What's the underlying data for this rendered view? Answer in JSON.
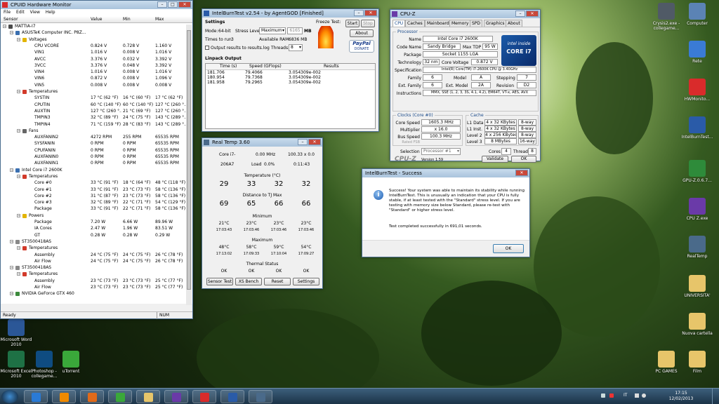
{
  "hwmon": {
    "title": "CPUID Hardware Monitor",
    "menu": [
      "File",
      "Edit",
      "View",
      "Help"
    ],
    "headers": [
      "Sensor",
      "Value",
      "Min",
      "Max"
    ],
    "rows": [
      {
        "indent": 0,
        "icon": "#4a4a4a",
        "label": "MATTIA-I7",
        "v": "",
        "mn": "",
        "mx": ""
      },
      {
        "indent": 1,
        "icon": "#3a6fb0",
        "label": "ASUSTeK Computer INC. P8Z...",
        "v": "",
        "mn": "",
        "mx": ""
      },
      {
        "indent": 2,
        "icon": "#e2b400",
        "label": "Voltages",
        "v": "",
        "mn": "",
        "mx": ""
      },
      {
        "indent": 3,
        "icon": "",
        "label": "CPU VCORE",
        "v": "0.824 V",
        "mn": "0.728 V",
        "mx": "1.160 V"
      },
      {
        "indent": 3,
        "icon": "",
        "label": "VIN1",
        "v": "1.016 V",
        "mn": "0.008 V",
        "mx": "1.016 V"
      },
      {
        "indent": 3,
        "icon": "",
        "label": "AVCC",
        "v": "3.376 V",
        "mn": "0.032 V",
        "mx": "3.392 V"
      },
      {
        "indent": 3,
        "icon": "",
        "label": "3VCC",
        "v": "3.376 V",
        "mn": "0.048 V",
        "mx": "3.392 V"
      },
      {
        "indent": 3,
        "icon": "",
        "label": "VIN4",
        "v": "1.016 V",
        "mn": "0.008 V",
        "mx": "1.016 V"
      },
      {
        "indent": 3,
        "icon": "",
        "label": "VIN6",
        "v": "0.872 V",
        "mn": "0.008 V",
        "mx": "1.096 V"
      },
      {
        "indent": 3,
        "icon": "",
        "label": "VIN5",
        "v": "0.008 V",
        "mn": "0.008 V",
        "mx": "0.008 V"
      },
      {
        "indent": 2,
        "icon": "#d23a2a",
        "label": "Temperatures",
        "v": "",
        "mn": "",
        "mx": ""
      },
      {
        "indent": 3,
        "icon": "",
        "label": "SYSTIN",
        "v": "17 °C (62 °F)",
        "mn": "16 °C (60 °F)",
        "mx": "17 °C (62 °F)"
      },
      {
        "indent": 3,
        "icon": "",
        "label": "CPUTIN",
        "v": "60 °C (140 °F)",
        "mn": "60 °C (140 °F)",
        "mx": "127 °C (260 °..."
      },
      {
        "indent": 3,
        "icon": "",
        "label": "AUXTIN",
        "v": "127 °C (260 °...",
        "mn": "21 °C (69 °F)",
        "mx": "127 °C (260 °..."
      },
      {
        "indent": 3,
        "icon": "",
        "label": "TMPIN3",
        "v": "32 °C (89 °F)",
        "mn": "24 °C (75 °F)",
        "mx": "143 °C (289 °..."
      },
      {
        "indent": 3,
        "icon": "",
        "label": "TMPIN4",
        "v": "71 °C (159 °F)",
        "mn": "28 °C (83 °F)",
        "mx": "143 °C (289 °..."
      },
      {
        "indent": 2,
        "icon": "#666666",
        "label": "Fans",
        "v": "",
        "mn": "",
        "mx": ""
      },
      {
        "indent": 3,
        "icon": "",
        "label": "AUXFANIN2",
        "v": "4272 RPM",
        "mn": "255 RPM",
        "mx": "65535 RPM"
      },
      {
        "indent": 3,
        "icon": "",
        "label": "SYSFANIN",
        "v": "0 RPM",
        "mn": "0 RPM",
        "mx": "65535 RPM"
      },
      {
        "indent": 3,
        "icon": "",
        "label": "CPUFANIN",
        "v": "0 RPM",
        "mn": "0 RPM",
        "mx": "65535 RPM"
      },
      {
        "indent": 3,
        "icon": "",
        "label": "AUXFANIN0",
        "v": "0 RPM",
        "mn": "0 RPM",
        "mx": "65535 RPM"
      },
      {
        "indent": 3,
        "icon": "",
        "label": "AUXFANIN1",
        "v": "0 RPM",
        "mn": "0 RPM",
        "mx": "65535 RPM"
      },
      {
        "indent": 1,
        "icon": "#3a6fb0",
        "label": "Intel Core i7 2600K",
        "v": "",
        "mn": "",
        "mx": ""
      },
      {
        "indent": 2,
        "icon": "#d23a2a",
        "label": "Temperatures",
        "v": "",
        "mn": "",
        "mx": ""
      },
      {
        "indent": 3,
        "icon": "",
        "label": "Core #0",
        "v": "33 °C (91 °F)",
        "mn": "18 °C (64 °F)",
        "mx": "48 °C (118 °F)"
      },
      {
        "indent": 3,
        "icon": "",
        "label": "Core #1",
        "v": "33 °C (91 °F)",
        "mn": "23 °C (73 °F)",
        "mx": "58 °C (136 °F)"
      },
      {
        "indent": 3,
        "icon": "",
        "label": "Core #2",
        "v": "31 °C (87 °F)",
        "mn": "23 °C (73 °F)",
        "mx": "58 °C (136 °F)"
      },
      {
        "indent": 3,
        "icon": "",
        "label": "Core #3",
        "v": "32 °C (89 °F)",
        "mn": "22 °C (71 °F)",
        "mx": "54 °C (129 °F)"
      },
      {
        "indent": 3,
        "icon": "",
        "label": "Package",
        "v": "33 °C (91 °F)",
        "mn": "22 °C (71 °F)",
        "mx": "58 °C (136 °F)"
      },
      {
        "indent": 2,
        "icon": "#e2b400",
        "label": "Powers",
        "v": "",
        "mn": "",
        "mx": ""
      },
      {
        "indent": 3,
        "icon": "",
        "label": "Package",
        "v": "7.20 W",
        "mn": "6.66 W",
        "mx": "89.96 W"
      },
      {
        "indent": 3,
        "icon": "",
        "label": "IA Cores",
        "v": "2.47 W",
        "mn": "1.96 W",
        "mx": "83.51 W"
      },
      {
        "indent": 3,
        "icon": "",
        "label": "GT",
        "v": "0.28 W",
        "mn": "0.28 W",
        "mx": "0.29 W"
      },
      {
        "indent": 1,
        "icon": "#888888",
        "label": "ST3500418AS",
        "v": "",
        "mn": "",
        "mx": ""
      },
      {
        "indent": 2,
        "icon": "#d23a2a",
        "label": "Temperatures",
        "v": "",
        "mn": "",
        "mx": ""
      },
      {
        "indent": 3,
        "icon": "",
        "label": "Assembly",
        "v": "24 °C (75 °F)",
        "mn": "24 °C (75 °F)",
        "mx": "26 °C (78 °F)"
      },
      {
        "indent": 3,
        "icon": "",
        "label": "Air Flow",
        "v": "24 °C (75 °F)",
        "mn": "24 °C (75 °F)",
        "mx": "26 °C (78 °F)"
      },
      {
        "indent": 1,
        "icon": "#888888",
        "label": "ST3500418AS",
        "v": "",
        "mn": "",
        "mx": ""
      },
      {
        "indent": 2,
        "icon": "#d23a2a",
        "label": "Temperatures",
        "v": "",
        "mn": "",
        "mx": ""
      },
      {
        "indent": 3,
        "icon": "",
        "label": "Assembly",
        "v": "23 °C (73 °F)",
        "mn": "23 °C (73 °F)",
        "mx": "25 °C (77 °F)"
      },
      {
        "indent": 3,
        "icon": "",
        "label": "Air Flow",
        "v": "23 °C (73 °F)",
        "mn": "23 °C (73 °F)",
        "mx": "25 °C (77 °F)"
      },
      {
        "indent": 1,
        "icon": "#3c8a3c",
        "label": "NVIDIA GeForce GTX 460",
        "v": "",
        "mn": "",
        "mx": ""
      }
    ],
    "status_left": "Ready",
    "status_right": "NUM"
  },
  "ibt": {
    "title": "IntelBurnTest v2.54 - by AgentGOD [Finished]",
    "settings": "Settings",
    "mode_label": "Mode:",
    "mode_value": "64-bit",
    "stress_label": "Stress Level:",
    "stress_value": "Maximum",
    "mem_value": "6165",
    "mem_unit": "MB",
    "times_label": "Times to run:",
    "times_value": "3",
    "avail_label": "Available RAM:",
    "avail_value": "6836 MB",
    "output_label": "Output results to results.log",
    "threads_label": "Threads:",
    "threads_value": "8",
    "freeze_label": "Freeze Test:",
    "start": "Start",
    "stop": "Stop",
    "about": "About",
    "paypal": "PayPal",
    "donate": "DONATE",
    "linpack": "Linpack Output",
    "cols": [
      "Time (s)",
      "Speed (GFlops)",
      "Results"
    ],
    "rows": [
      [
        "181.706",
        "79.4066",
        "3.054309e-002"
      ],
      [
        "180.954",
        "79.7368",
        "3.054309e-002"
      ],
      [
        "181.958",
        "79.2965",
        "3.054309e-002"
      ]
    ]
  },
  "cpuz": {
    "title": "CPU-Z",
    "tabs": [
      "CPU",
      "Caches",
      "Mainboard",
      "Memory",
      "SPD",
      "Graphics",
      "About"
    ],
    "processor": "Processor",
    "name_l": "Name",
    "name_v": "Intel Core i7 2600K",
    "code_l": "Code Name",
    "code_v": "Sandy Bridge",
    "tdp_l": "Max TDP",
    "tdp_v": "95 W",
    "pkg_l": "Package",
    "pkg_v": "Socket 1155 LGA",
    "tech_l": "Technology",
    "tech_v": "32 nm",
    "cv_l": "Core Voltage",
    "cv_v": "0.872 V",
    "spec_l": "Specification",
    "spec_v": "Intel(R) Core(TM) i7-2600K CPU @ 3.40GHz",
    "fam_l": "Family",
    "fam_v": "6",
    "model_l": "Model",
    "model_v": "A",
    "step_l": "Stepping",
    "step_v": "7",
    "efam_l": "Ext. Family",
    "efam_v": "6",
    "emod_l": "Ext. Model",
    "emod_v": "2A",
    "rev_l": "Revision",
    "rev_v": "D2",
    "instr_l": "Instructions",
    "instr_v": "MMX, SSE (1, 2, 3, 3S, 4.1, 4.2), EM64T, VT-x, AES, AVX",
    "clocks": "Clocks (Core #0)",
    "cs_l": "Core Speed",
    "cs_v": "1605.3 MHz",
    "mult_l": "Multiplier",
    "mult_v": "x 16.0",
    "bus_l": "Bus Speed",
    "bus_v": "100.3 MHz",
    "fsb_l": "Rated FSB",
    "cache": "Cache",
    "l1d_l": "L1 Data",
    "l1d_v": "4 x 32 KBytes",
    "l1d_w": "8-way",
    "l1i_l": "L1 Inst.",
    "l1i_v": "4 x 32 KBytes",
    "l1i_w": "8-way",
    "l2_l": "Level 2",
    "l2_v": "4 x 256 KBytes",
    "l2_w": "8-way",
    "l3_l": "Level 3",
    "l3_v": "8 MBytes",
    "l3_w": "16-way",
    "sel_l": "Selection",
    "sel_v": "Processor #1",
    "cores_l": "Cores",
    "cores_v": "4",
    "thr_l": "Threads",
    "thr_v": "8",
    "brand": "CPU-Z",
    "version": "Version 1.59",
    "validate": "Validate",
    "ok": "OK",
    "intel_inside": "intel inside",
    "intel_core": "CORE i7"
  },
  "realtemp": {
    "title": "Real Temp 3.60",
    "cpu_l": "Core i7-",
    "mhz": "0.00 MHz",
    "mult": "100.33 x 0.0",
    "id": "206A7",
    "load_l": "Load",
    "load_v": "0.0%",
    "time": "0:11:43",
    "temp_h": "Temperature (°C)",
    "temps": [
      "29",
      "33",
      "32",
      "32"
    ],
    "dist_h": "Distance to TJ Max",
    "dist": [
      "69",
      "65",
      "66",
      "66"
    ],
    "min_h": "Minimum",
    "min_t": [
      "21°C",
      "23°C",
      "23°C",
      "23°C"
    ],
    "min_time": [
      "17:03:43",
      "17:03:46",
      "17:03:46",
      "17:03:46"
    ],
    "max_h": "Maximum",
    "max_t": [
      "48°C",
      "58°C",
      "59°C",
      "54°C"
    ],
    "max_time": [
      "17:13:02",
      "17:09:33",
      "17:10:04",
      "17:09:27"
    ],
    "therm_h": "Thermal Status",
    "therm": [
      "OK",
      "OK",
      "OK",
      "OK"
    ],
    "btns": [
      "Sensor Test",
      "XS Bench",
      "Reset",
      "Settings"
    ]
  },
  "dialog": {
    "title": "IntelBurnTest - Success",
    "message": "Success! Your system was able to maintain its stability while running IntelBurnTest. This is unusually an indication that your CPU is fully stable, if at least tested with the \"Standard\" stress level. If you are testing with memory size below Standard, please re-test with \"Standard\" or higher stress level.",
    "completed": "Test completed successfully in 691,01 seconds.",
    "ok": "OK"
  },
  "desktop": {
    "left": [
      {
        "label": "Microsoft Word 2010",
        "color": "#2b5797"
      },
      {
        "label": "Microsoft Excel 2010",
        "color": "#1e7145"
      },
      {
        "label": "Photoshop - collegame...",
        "color": "#0f4c81"
      },
      {
        "label": "uTorrent",
        "color": "#3aa83a"
      }
    ],
    "right": [
      {
        "label": "Crysis2.exe - collegame...",
        "color": "#505a66"
      },
      {
        "label": "Computer",
        "color": "#5b83b5"
      },
      {
        "label": "Rete",
        "color": "#3a7bd5"
      },
      {
        "label": "HWMonito...",
        "color": "#d92b2b"
      },
      {
        "label": "IntelBurnTest...",
        "color": "#2a5ba8"
      },
      {
        "label": "GPU-Z.0.6.7...",
        "color": "#2e8b3a"
      },
      {
        "label": "CPU Z.exe",
        "color": "#6a3aa8"
      },
      {
        "label": "RealTemp",
        "color": "#4a6a8a"
      },
      {
        "label": "UNIVERSITA'",
        "color": "#e7c56a"
      },
      {
        "label": "Nuova cartella",
        "color": "#e7c56a"
      },
      {
        "label": "PC GAMES",
        "color": "#e7c56a"
      },
      {
        "label": "Film",
        "color": "#e7c56a"
      }
    ]
  },
  "taskbar": {
    "apps": [
      {
        "name": "start-orb",
        "color": "#3f8bd0"
      },
      {
        "name": "internet-explorer",
        "color": "#2a7ad5"
      },
      {
        "name": "vlc",
        "color": "#f08a00"
      },
      {
        "name": "firefox",
        "color": "#e06a1a"
      },
      {
        "name": "utorrent",
        "color": "#3aa83a"
      },
      {
        "name": "folder",
        "color": "#e7c56a"
      },
      {
        "name": "cpu-z",
        "color": "#6a3aa8"
      },
      {
        "name": "hwmonitor",
        "color": "#d92b2b"
      },
      {
        "name": "intelburntest",
        "color": "#2a5ba8"
      },
      {
        "name": "realtemp",
        "color": "#4a6a8a"
      }
    ],
    "lang": "IT",
    "time": "17:15",
    "date": "12/02/2013"
  }
}
